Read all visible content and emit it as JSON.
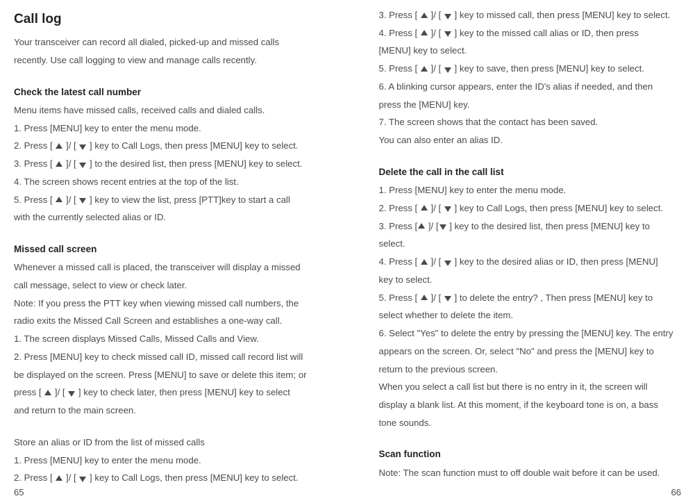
{
  "left": {
    "h1": "Call log",
    "intro1": "Your transceiver can record all dialed, picked-up and missed calls",
    "intro2": "recently. Use call logging to view and manage calls recently.",
    "h2a": "Check the latest call number",
    "a1": "Menu items have missed calls, received calls and dialed calls.",
    "a2": "1. Press [MENU] key to enter the menu mode.",
    "a3a": "2. Press [ ",
    "a3b": " ]/ [ ",
    "a3c": " ] key to Call Logs, then press [MENU] key to select.",
    "a4a": "3. Press [ ",
    "a4b": " ]/ [ ",
    "a4c": " ] to the desired list, then press [MENU] key to select.",
    "a5": "4. The screen shows recent entries at the top of the list.",
    "a6a": "5. Press [ ",
    "a6b": " ]/ [ ",
    "a6c": " ] key to view the list, press [PTT]key to start a call",
    "a7": "with the currently selected alias or ID.",
    "h2b": "Missed call screen",
    "b1": "Whenever a missed call is placed, the transceiver will display a missed",
    "b2": "call message, select to view or check later.",
    "b3": "Note: If you press the PTT key when viewing missed call numbers, the",
    "b4": "radio exits the Missed Call Screen and establishes a one-way call.",
    "b5": "1. The screen displays Missed Calls, Missed Calls and View.",
    "b6": "2. Press [MENU] key to check missed call ID, missed call record list will",
    "b7": "be displayed on the screen. Press [MENU] to save or delete this item; or",
    "b8a": "press [ ",
    "b8b": " ]/ [ ",
    "b8c": " ] key to check later, then press [MENU] key to select",
    "b9": "and return to the main screen.",
    "c0": "Store an alias or ID from the list of missed calls",
    "c1": "1. Press [MENU] key to enter the menu mode.",
    "c2a": "2. Press [ ",
    "c2b": " ]/ [ ",
    "c2c": " ] key to Call Logs, then press [MENU] key to select."
  },
  "right": {
    "r1a": "3. Press [ ",
    "r1b": " ]/ [ ",
    "r1c": " ] key to missed call, then press [MENU] key to select.",
    "r2a": "4. Press [ ",
    "r2b": " ]/ [ ",
    "r2c": " ] key to the missed call alias or ID, then press",
    "r3": "[MENU] key to select.",
    "r4a": "5. Press [ ",
    "r4b": " ]/ [ ",
    "r4c": " ] key to save, then press [MENU] key to select.",
    "r5": "6. A blinking cursor appears, enter the ID's alias if needed, and then",
    "r6": "press the [MENU] key.",
    "r7": "7. The screen shows that the contact has been saved.",
    "r8": "You can also enter an alias ID.",
    "h2d": "Delete the call in the call list",
    "d1": "1. Press [MENU] key to enter the menu mode.",
    "d2a": "2. Press [ ",
    "d2b": " ]/ [ ",
    "d2c": " ] key to Call Logs, then press [MENU] key to select.",
    "d3a": "3. Press  [",
    "d3b": "  ]/ [",
    "d3c": "  ] key to the desired list, then press [MENU] key to",
    "d4": "select.",
    "d5a": "4. Press [ ",
    "d5b": " ]/ [ ",
    "d5c": " ] key to the desired alias or ID, then press [MENU]",
    "d6": "key to select.",
    "d7a": "5. Press [ ",
    "d7b": " ]/ [ ",
    "d7c": " ] to delete the entry? , Then press [MENU] key to",
    "d8": "select whether to delete the item.",
    "d9": "6. Select \"Yes\" to delete the entry by pressing the [MENU] key. The entry",
    "d10": "appears on the screen. Or, select \"No\" and press the [MENU] key to",
    "d11": "return to the previous screen.",
    "d12": "When you select a call list but there is no entry in it, the screen will",
    "d13": "display a blank list. At this moment, if the keyboard tone is on, a bass",
    "d14": "tone sounds.",
    "h2e": "Scan function",
    "e1": "Note: The scan function must to off double wait before it can be used."
  },
  "pages": {
    "left": "65",
    "right": "66"
  }
}
